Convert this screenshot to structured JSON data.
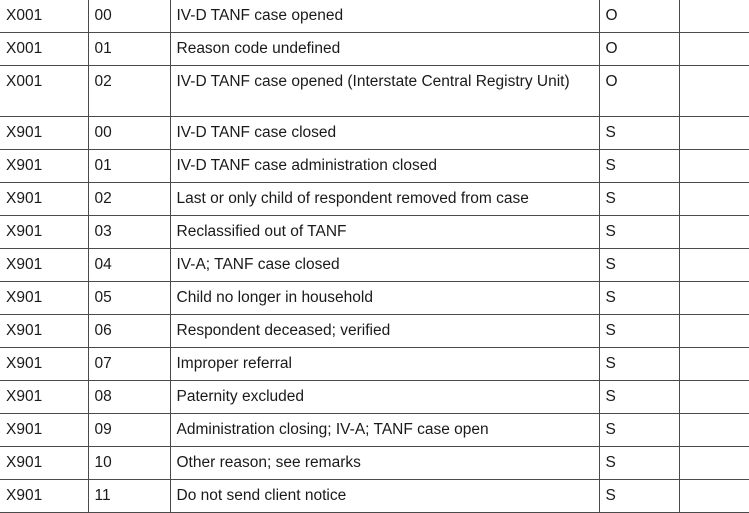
{
  "rows": [
    {
      "code": "X001",
      "sub": "00",
      "description": "IV-D TANF case opened",
      "flag": "O",
      "extra": ""
    },
    {
      "code": "X001",
      "sub": "01",
      "description": "Reason code undefined",
      "flag": "O",
      "extra": ""
    },
    {
      "code": "X001",
      "sub": "02",
      "description": "IV-D TANF case opened (Interstate Central Registry Unit)",
      "flag": "O",
      "extra": ""
    },
    {
      "code": "X901",
      "sub": "00",
      "description": "IV-D TANF case closed",
      "flag": "S",
      "extra": ""
    },
    {
      "code": "X901",
      "sub": "01",
      "description": "IV-D TANF case administration closed",
      "flag": "S",
      "extra": ""
    },
    {
      "code": "X901",
      "sub": "02",
      "description": "Last or only child of respondent removed from case",
      "flag": "S",
      "extra": ""
    },
    {
      "code": "X901",
      "sub": "03",
      "description": "Reclassified out of TANF",
      "flag": "S",
      "extra": ""
    },
    {
      "code": "X901",
      "sub": "04",
      "description": "IV-A; TANF case closed",
      "flag": "S",
      "extra": ""
    },
    {
      "code": "X901",
      "sub": "05",
      "description": "Child no longer in household",
      "flag": "S",
      "extra": ""
    },
    {
      "code": "X901",
      "sub": "06",
      "description": "Respondent deceased; verified",
      "flag": "S",
      "extra": ""
    },
    {
      "code": "X901",
      "sub": "07",
      "description": "Improper referral",
      "flag": "S",
      "extra": ""
    },
    {
      "code": "X901",
      "sub": "08",
      "description": "Paternity excluded",
      "flag": "S",
      "extra": ""
    },
    {
      "code": "X901",
      "sub": "09",
      "description": "Administration closing; IV-A; TANF case open",
      "flag": "S",
      "extra": ""
    },
    {
      "code": "X901",
      "sub": "10",
      "description": "Other reason; see remarks",
      "flag": "S",
      "extra": ""
    },
    {
      "code": "X901",
      "sub": "11",
      "description": "Do not send client notice",
      "flag": "S",
      "extra": ""
    }
  ]
}
